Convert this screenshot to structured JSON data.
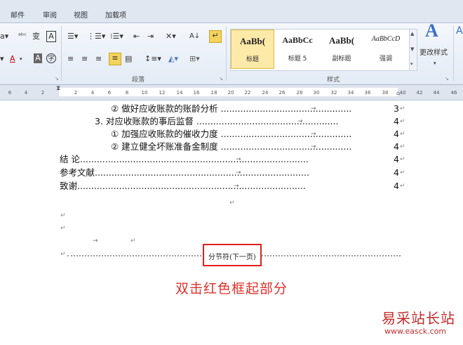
{
  "tabs": [
    "邮件",
    "审阅",
    "视图",
    "加载项"
  ],
  "ribbon": {
    "paragraph_group_label": "段落",
    "styles_group_label": "样式",
    "change_styles_label": "更改样式",
    "styles": [
      {
        "preview": "AaBb(",
        "name": "标题"
      },
      {
        "preview": "AaBbCc",
        "name": "标题 5"
      },
      {
        "preview": "AaBb(",
        "name": "副标题"
      },
      {
        "preview": "AaBbCcD",
        "name": "强调"
      }
    ]
  },
  "ruler": {
    "ticks": [
      "6",
      "4",
      "2",
      "2",
      "4",
      "6",
      "8",
      "10",
      "12",
      "14",
      "16",
      "18",
      "20",
      "22",
      "24",
      "26",
      "28",
      "30",
      "32",
      "34",
      "36",
      "38",
      "40",
      "42",
      "44",
      "46"
    ]
  },
  "toc": [
    {
      "text": "② 做好应收账款的账龄分析 ...............................................",
      "page": "3"
    },
    {
      "text": "3. 对应收账款的事后监督 ...................................................",
      "page": "4"
    },
    {
      "text": "① 加强应收账款的催收力度 ...............................................",
      "page": "4"
    },
    {
      "text": "② 建立健全坏账准备金制度 ...............................................",
      "page": "4"
    },
    {
      "text": "结 论..................................................................................",
      "page": "4"
    },
    {
      "text": "参考文献.............................................................................",
      "page": "4"
    },
    {
      "text": "致谢..................................................................................",
      "page": "4"
    }
  ],
  "section_break": "分节符(下一页)",
  "instruction": "双击红色框起部分",
  "watermark": {
    "cn": "易采站长站",
    "url": "www.easck.com"
  }
}
